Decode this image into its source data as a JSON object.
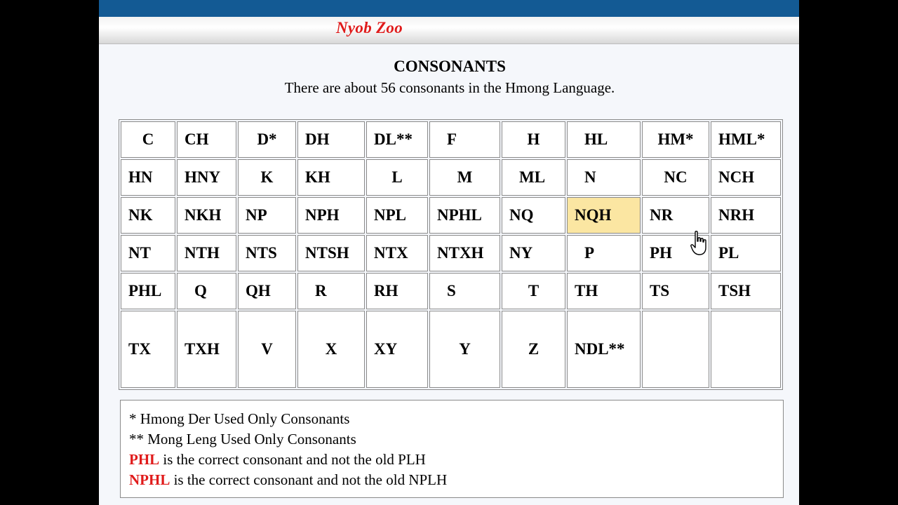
{
  "header": {
    "site_title": "Nyob Zoo"
  },
  "content": {
    "heading": "CONSONANTS",
    "subheading": "There are about 56 consonants in the Hmong Language."
  },
  "consonants": {
    "rows": [
      [
        "C",
        "CH",
        "D*",
        "DH",
        "DL**",
        "F",
        "H",
        "HL",
        "HM*",
        "HML*"
      ],
      [
        "HN",
        "HNY",
        "K",
        "KH",
        "L",
        "M",
        "ML",
        "N",
        "NC",
        "NCH"
      ],
      [
        "NK",
        "NKH",
        "NP",
        "NPH",
        "NPL",
        "NPHL",
        "NQ",
        "NQH",
        "NR",
        "NRH"
      ],
      [
        "NT",
        "NTH",
        "NTS",
        "NTSH",
        "NTX",
        "NTXH",
        "NY",
        "P",
        "PH",
        "PL"
      ],
      [
        "PHL",
        "Q",
        "QH",
        "R",
        "RH",
        "S",
        "T",
        "TH",
        "TS",
        "TSH"
      ],
      [
        "TX",
        "TXH",
        "V",
        "X",
        "XY",
        "Y",
        "Z",
        "NDL**",
        "",
        ""
      ]
    ],
    "highlighted": "NQH"
  },
  "notes": {
    "line1": "* Hmong Der Used Only Consonants",
    "line2": "** Mong Leng Used Only Consonants",
    "line3_red": "PHL",
    "line3_rest": " is the correct consonant and not the old PLH",
    "line4_red": "NPHL",
    "line4_rest": " is the correct consonant and not the old NPLH"
  },
  "colors": {
    "top_bar": "#135a94",
    "title_red": "#e01b1b",
    "highlight": "#fbe6a2"
  },
  "icons": {
    "cursor": "hand-pointer-icon"
  }
}
